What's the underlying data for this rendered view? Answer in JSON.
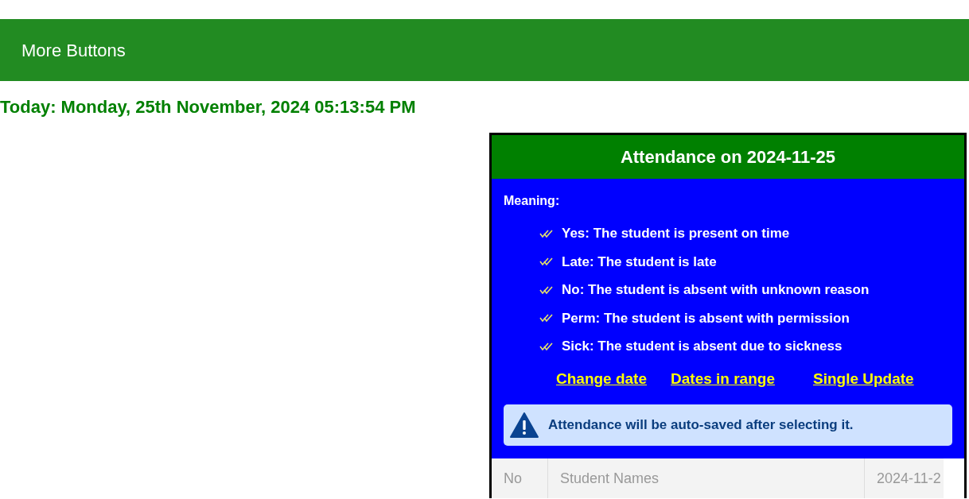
{
  "top_bar": {
    "label": "More Buttons"
  },
  "today": "Today: Monday, 25th November, 2024 05:13:54 PM",
  "panel": {
    "title": "Attendance on 2024-11-25",
    "meaning_label": "Meaning:",
    "legend": [
      "Yes: The student is present on time",
      "Late: The student is late",
      "No: The student is absent with unknown reason",
      "Perm: The student is absent with permission",
      "Sick: The student is absent due to sickness"
    ],
    "links": [
      "Change date",
      "Dates in range",
      "Single Update"
    ],
    "notice": "Attendance will be auto-saved after selecting it.",
    "table": {
      "columns": [
        "No",
        "Student Names",
        "2024-11-2"
      ]
    }
  }
}
